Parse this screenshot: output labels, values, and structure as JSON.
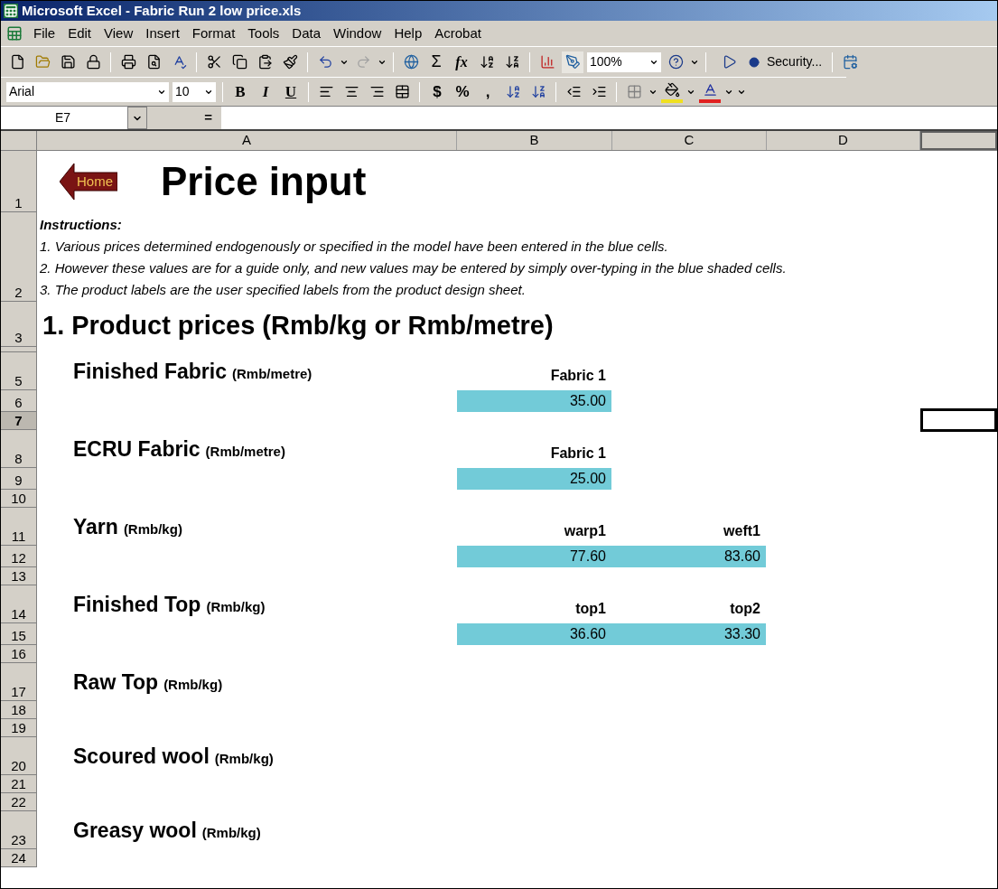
{
  "window": {
    "title": "Microsoft Excel - Fabric Run 2 low price.xls"
  },
  "menu": [
    "File",
    "Edit",
    "View",
    "Insert",
    "Format",
    "Tools",
    "Data",
    "Window",
    "Help",
    "Acrobat"
  ],
  "standard_toolbar": {
    "sigma": "Σ",
    "function": "fx",
    "zoom": "100%",
    "security": "Security..."
  },
  "formatting_toolbar": {
    "font": "Arial",
    "size": "10",
    "bold": "B",
    "italic": "I",
    "underline": "U",
    "currency": "$",
    "percent": "%",
    "comma": ","
  },
  "formula_bar": {
    "name_box": "E7",
    "equals": "="
  },
  "columns": [
    "A",
    "B",
    "C",
    "D"
  ],
  "rows": [
    {
      "number": "1",
      "selected": false,
      "kind": "title",
      "button": "Home",
      "title": "Price input"
    },
    {
      "number": "2",
      "selected": false,
      "kind": "instructions",
      "heading": "Instructions:",
      "lines": [
        "1. Various prices determined endogenously or specified in the model have been entered in the blue cells.",
        "2.  However these values are for a guide only, and new values may be entered by simply over-typing in the blue shaded cells.",
        "3. The product labels are the user specified labels from the product design sheet."
      ]
    },
    {
      "number": "3",
      "selected": false,
      "kind": "section",
      "text": "1. Product prices (Rmb/kg or Rmb/metre)"
    },
    {
      "kind": "collapsed"
    },
    {
      "number": "5",
      "selected": false,
      "kind": "product",
      "name": "Finished Fabric",
      "unit": "(Rmb/metre)",
      "headers": [
        "Fabric 1"
      ]
    },
    {
      "number": "6",
      "selected": false,
      "kind": "values",
      "values": [
        "35.00"
      ]
    },
    {
      "number": "7",
      "selected": true,
      "kind": "blank"
    },
    {
      "number": "8",
      "selected": false,
      "kind": "product",
      "name": "ECRU Fabric",
      "unit": "(Rmb/metre)",
      "headers": [
        "Fabric 1"
      ]
    },
    {
      "number": "9",
      "selected": false,
      "kind": "values",
      "values": [
        "25.00"
      ]
    },
    {
      "number": "10",
      "selected": false,
      "kind": "blank"
    },
    {
      "number": "11",
      "selected": false,
      "kind": "product",
      "name": "Yarn",
      "unit": "(Rmb/kg)",
      "headers": [
        "warp1",
        "weft1"
      ]
    },
    {
      "number": "12",
      "selected": false,
      "kind": "values",
      "values": [
        "77.60",
        "83.60"
      ]
    },
    {
      "number": "13",
      "selected": false,
      "kind": "blank"
    },
    {
      "number": "14",
      "selected": false,
      "kind": "product",
      "name": "Finished Top",
      "unit": "(Rmb/kg)",
      "headers": [
        "top1",
        "top2"
      ]
    },
    {
      "number": "15",
      "selected": false,
      "kind": "values",
      "values": [
        "36.60",
        "33.30"
      ]
    },
    {
      "number": "16",
      "selected": false,
      "kind": "blank"
    },
    {
      "number": "17",
      "selected": false,
      "kind": "product",
      "name": "Raw Top",
      "unit": "(Rmb/kg)",
      "headers": []
    },
    {
      "number": "18",
      "selected": false,
      "kind": "blank"
    },
    {
      "number": "19",
      "selected": false,
      "kind": "blank"
    },
    {
      "number": "20",
      "selected": false,
      "kind": "product",
      "name": "Scoured wool",
      "unit": "(Rmb/kg)",
      "headers": []
    },
    {
      "number": "21",
      "selected": false,
      "kind": "blank"
    },
    {
      "number": "22",
      "selected": false,
      "kind": "blank"
    },
    {
      "number": "23",
      "selected": false,
      "kind": "product",
      "name": "Greasy wool",
      "unit": "(Rmb/kg)",
      "headers": []
    },
    {
      "number": "24",
      "selected": false,
      "kind": "blank"
    }
  ]
}
